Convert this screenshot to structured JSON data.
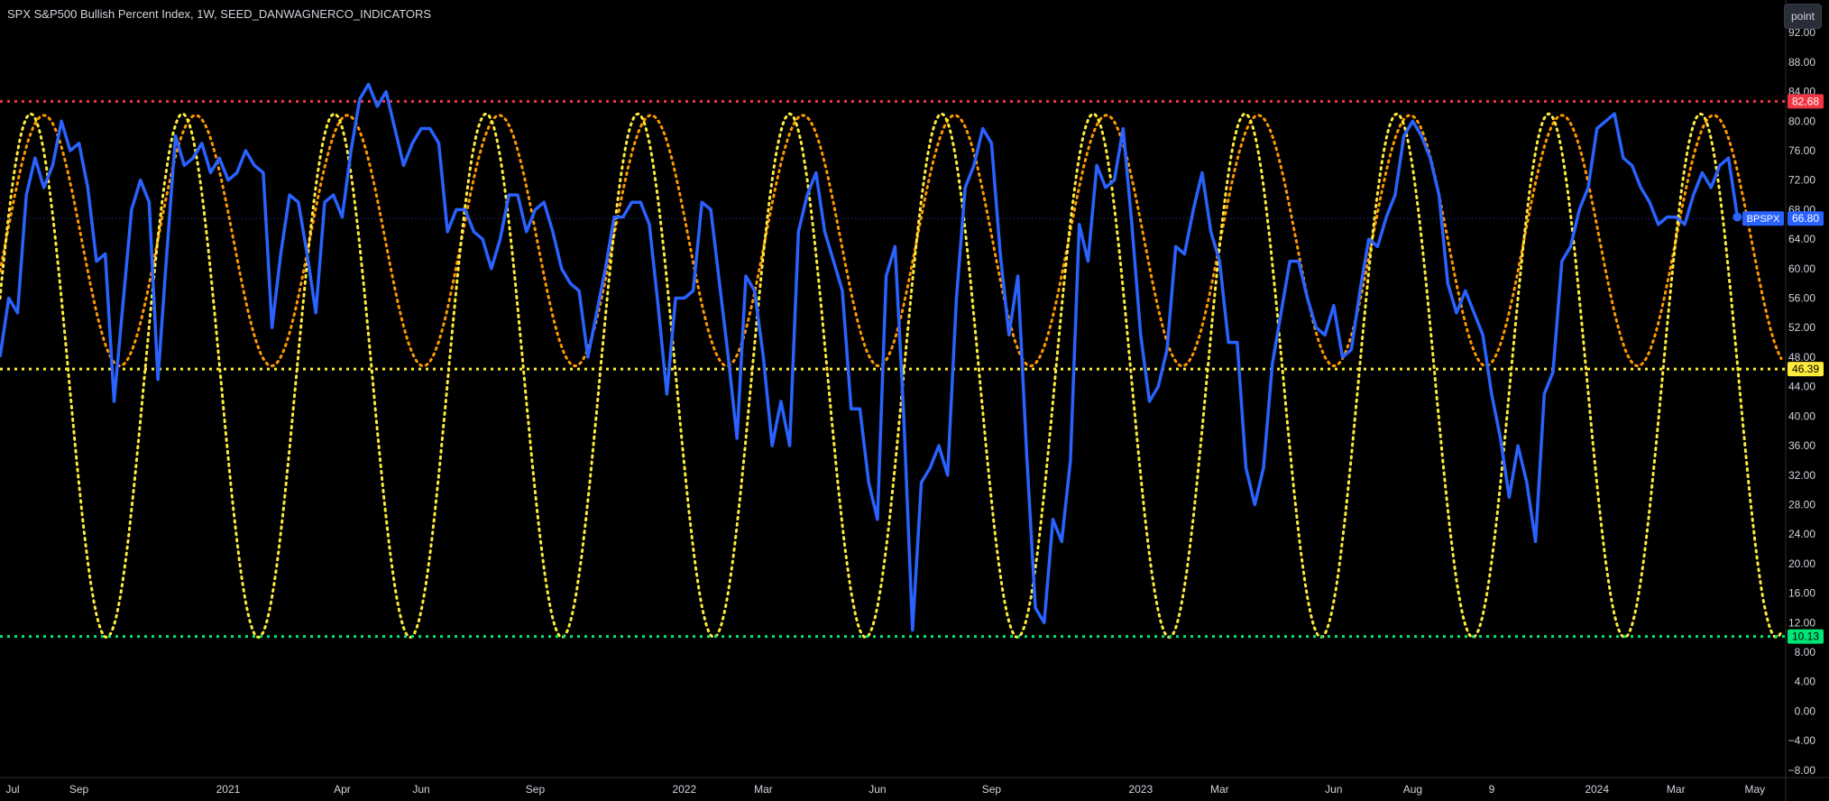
{
  "header": {
    "title": "SPX S&P500 Bullish Percent Index, 1W, SEED_DANWAGNERCO_INDICATORS",
    "point_button": "point"
  },
  "colors": {
    "background": "#000000",
    "main_line": "#2962ff",
    "orange_cycle": "#ff9800",
    "yellow_cycle": "#ffeb3b",
    "upper_line": "#f23645",
    "mid_line": "#ffeb3b",
    "lower_line": "#00e676",
    "axis_text": "#d1d4dc"
  },
  "chart_data": {
    "type": "line",
    "title": "SPX S&P500 Bullish Percent Index, 1W, SEED_DANWAGNERCO_INDICATORS",
    "ylim": [
      -9,
      93
    ],
    "y_ticks": [
      "92.00",
      "88.00",
      "84.00",
      "80.00",
      "76.00",
      "72.00",
      "68.00",
      "64.00",
      "60.00",
      "56.00",
      "52.00",
      "48.00",
      "44.00",
      "40.00",
      "36.00",
      "32.00",
      "28.00",
      "24.00",
      "20.00",
      "16.00",
      "12.00",
      "8.00",
      "4.00",
      "0.00",
      "−4.00",
      "−8.00"
    ],
    "x_labels": [
      {
        "label": "Jul",
        "week": 0
      },
      {
        "label": "Sep",
        "week": 9
      },
      {
        "label": "2021",
        "week": 26
      },
      {
        "label": "Apr",
        "week": 39
      },
      {
        "label": "Jun",
        "week": 48
      },
      {
        "label": "Sep",
        "week": 61
      },
      {
        "label": "2022",
        "week": 78
      },
      {
        "label": "Mar",
        "week": 87
      },
      {
        "label": "Jun",
        "week": 100
      },
      {
        "label": "Sep",
        "week": 113
      },
      {
        "label": "2023",
        "week": 130
      },
      {
        "label": "Mar",
        "week": 139
      },
      {
        "label": "Jun",
        "week": 152
      },
      {
        "label": "Aug",
        "week": 161
      },
      {
        "label": "9",
        "week": 170
      },
      {
        "label": "2024",
        "week": 182
      },
      {
        "label": "Mar",
        "week": 191
      },
      {
        "label": "May",
        "week": 200
      }
    ],
    "x_range": [
      0,
      203
    ],
    "horizontal_lines": [
      {
        "name": "upper",
        "value": 82.68,
        "label": "82.68",
        "color": "#f23645"
      },
      {
        "name": "mid",
        "value": 46.39,
        "label": "46.39",
        "color": "#ffeb3b"
      },
      {
        "name": "lower",
        "value": 10.13,
        "label": "10.13",
        "color": "#00e676"
      }
    ],
    "last_value": {
      "name": "BPSPX",
      "value": 66.8,
      "label": "66.80"
    },
    "series": [
      {
        "name": "BPSPX",
        "color": "#2962ff",
        "points": [
          [
            0,
            48
          ],
          [
            1,
            56
          ],
          [
            2,
            54
          ],
          [
            3,
            70
          ],
          [
            4,
            75
          ],
          [
            5,
            71
          ],
          [
            6,
            74
          ],
          [
            7,
            80
          ],
          [
            8,
            76
          ],
          [
            9,
            77
          ],
          [
            10,
            71
          ],
          [
            11,
            61
          ],
          [
            12,
            62
          ],
          [
            13,
            42
          ],
          [
            14,
            55
          ],
          [
            15,
            68
          ],
          [
            16,
            72
          ],
          [
            17,
            69
          ],
          [
            18,
            45
          ],
          [
            19,
            62
          ],
          [
            20,
            78
          ],
          [
            21,
            74
          ],
          [
            22,
            75
          ],
          [
            23,
            77
          ],
          [
            24,
            73
          ],
          [
            25,
            75
          ],
          [
            26,
            72
          ],
          [
            27,
            73
          ],
          [
            28,
            76
          ],
          [
            29,
            74
          ],
          [
            30,
            73
          ],
          [
            31,
            52
          ],
          [
            32,
            62
          ],
          [
            33,
            70
          ],
          [
            34,
            69
          ],
          [
            35,
            62
          ],
          [
            36,
            54
          ],
          [
            37,
            69
          ],
          [
            38,
            70
          ],
          [
            39,
            67
          ],
          [
            40,
            76
          ],
          [
            41,
            83
          ],
          [
            42,
            85
          ],
          [
            43,
            82
          ],
          [
            44,
            84
          ],
          [
            45,
            79
          ],
          [
            46,
            74
          ],
          [
            47,
            77
          ],
          [
            48,
            79
          ],
          [
            49,
            79
          ],
          [
            50,
            77
          ],
          [
            51,
            65
          ],
          [
            52,
            68
          ],
          [
            53,
            68
          ],
          [
            54,
            65
          ],
          [
            55,
            64
          ],
          [
            56,
            60
          ],
          [
            57,
            64
          ],
          [
            58,
            70
          ],
          [
            59,
            70
          ],
          [
            60,
            65
          ],
          [
            61,
            68
          ],
          [
            62,
            69
          ],
          [
            63,
            65
          ],
          [
            64,
            60
          ],
          [
            65,
            58
          ],
          [
            66,
            57
          ],
          [
            67,
            48
          ],
          [
            68,
            54
          ],
          [
            69,
            60
          ],
          [
            70,
            67
          ],
          [
            71,
            67
          ],
          [
            72,
            69
          ],
          [
            73,
            69
          ],
          [
            74,
            66
          ],
          [
            75,
            55
          ],
          [
            76,
            43
          ],
          [
            77,
            56
          ],
          [
            78,
            56
          ],
          [
            79,
            57
          ],
          [
            80,
            69
          ],
          [
            81,
            68
          ],
          [
            82,
            58
          ],
          [
            83,
            48
          ],
          [
            84,
            37
          ],
          [
            85,
            59
          ],
          [
            86,
            57
          ],
          [
            87,
            48
          ],
          [
            88,
            36
          ],
          [
            89,
            42
          ],
          [
            90,
            36
          ],
          [
            91,
            65
          ],
          [
            92,
            70
          ],
          [
            93,
            73
          ],
          [
            94,
            65
          ],
          [
            95,
            61
          ],
          [
            96,
            57
          ],
          [
            97,
            41
          ],
          [
            98,
            41
          ],
          [
            99,
            31
          ],
          [
            100,
            26
          ],
          [
            101,
            59
          ],
          [
            102,
            63
          ],
          [
            103,
            40
          ],
          [
            104,
            11
          ],
          [
            105,
            31
          ],
          [
            106,
            33
          ],
          [
            107,
            36
          ],
          [
            108,
            32
          ],
          [
            109,
            56
          ],
          [
            110,
            71
          ],
          [
            111,
            74
          ],
          [
            112,
            79
          ],
          [
            113,
            77
          ],
          [
            114,
            62
          ],
          [
            115,
            51
          ],
          [
            116,
            59
          ],
          [
            117,
            35
          ],
          [
            118,
            14
          ],
          [
            119,
            12
          ],
          [
            120,
            26
          ],
          [
            121,
            23
          ],
          [
            122,
            34
          ],
          [
            123,
            66
          ],
          [
            124,
            61
          ],
          [
            125,
            74
          ],
          [
            126,
            71
          ],
          [
            127,
            72
          ],
          [
            128,
            79
          ],
          [
            129,
            66
          ],
          [
            130,
            51
          ],
          [
            131,
            42
          ],
          [
            132,
            44
          ],
          [
            133,
            49
          ],
          [
            134,
            63
          ],
          [
            135,
            62
          ],
          [
            136,
            68
          ],
          [
            137,
            73
          ],
          [
            138,
            65
          ],
          [
            139,
            61
          ],
          [
            140,
            50
          ],
          [
            141,
            50
          ],
          [
            142,
            33
          ],
          [
            143,
            28
          ],
          [
            144,
            33
          ],
          [
            145,
            47
          ],
          [
            146,
            54
          ],
          [
            147,
            61
          ],
          [
            148,
            61
          ],
          [
            149,
            56
          ],
          [
            150,
            52
          ],
          [
            151,
            51
          ],
          [
            152,
            55
          ],
          [
            153,
            48
          ],
          [
            154,
            49
          ],
          [
            155,
            57
          ],
          [
            156,
            64
          ],
          [
            157,
            63
          ],
          [
            158,
            67
          ],
          [
            159,
            70
          ],
          [
            160,
            78
          ],
          [
            161,
            80
          ],
          [
            162,
            78
          ],
          [
            163,
            75
          ],
          [
            164,
            70
          ],
          [
            165,
            58
          ],
          [
            166,
            54
          ],
          [
            167,
            57
          ],
          [
            168,
            54
          ],
          [
            169,
            51
          ],
          [
            170,
            43
          ],
          [
            171,
            37
          ],
          [
            172,
            29
          ],
          [
            173,
            36
          ],
          [
            174,
            31
          ],
          [
            175,
            23
          ],
          [
            176,
            43
          ],
          [
            177,
            46
          ],
          [
            178,
            61
          ],
          [
            179,
            63
          ],
          [
            180,
            68
          ],
          [
            181,
            71
          ],
          [
            182,
            79
          ],
          [
            183,
            80
          ],
          [
            184,
            81
          ],
          [
            185,
            75
          ],
          [
            186,
            74
          ],
          [
            187,
            71
          ],
          [
            188,
            69
          ],
          [
            189,
            66
          ],
          [
            190,
            67
          ],
          [
            191,
            67
          ],
          [
            192,
            66
          ],
          [
            193,
            70
          ],
          [
            194,
            73
          ],
          [
            195,
            71
          ],
          [
            196,
            74
          ],
          [
            197,
            75
          ],
          [
            198,
            67
          ]
        ]
      },
      {
        "name": "orange-cycle",
        "color": "#ff9800",
        "type": "sine",
        "center": 63.8,
        "amplitude": 17,
        "period": 17.3,
        "peak_week": 5,
        "x_range": [
          0,
          203
        ]
      },
      {
        "name": "yellow-cycle",
        "color": "#ffeb3b",
        "type": "sine",
        "center": 45.5,
        "amplitude": 35.5,
        "period": 17.3,
        "peak_week": 3.5,
        "x_range": [
          0,
          203
        ]
      }
    ]
  }
}
